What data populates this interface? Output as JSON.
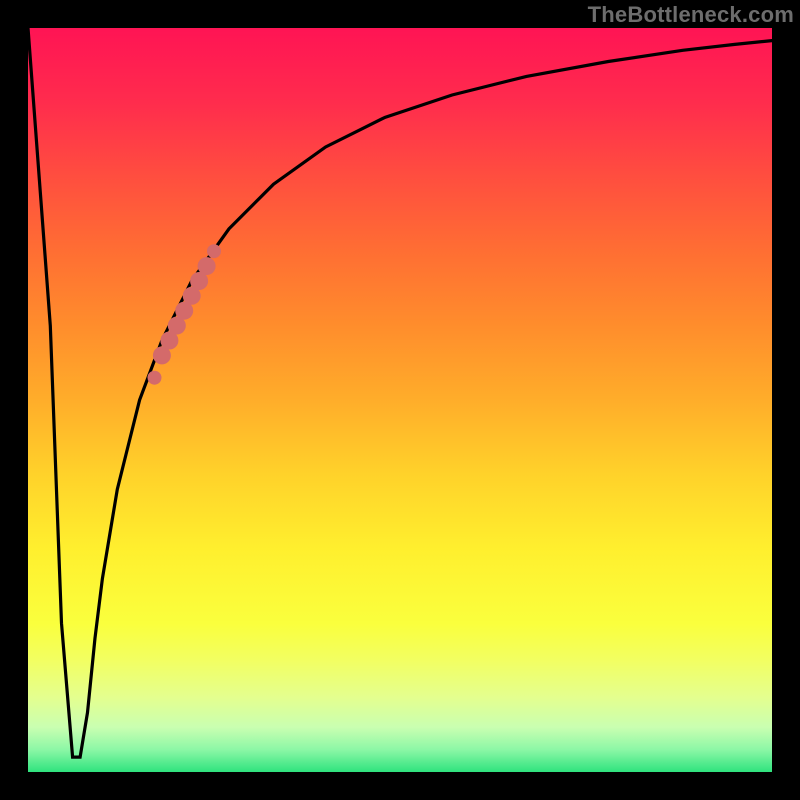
{
  "watermark": "TheBottleneck.com",
  "chart_data": {
    "type": "line",
    "title": "",
    "xlabel": "",
    "ylabel": "",
    "xlim": [
      0,
      100
    ],
    "ylim": [
      0,
      100
    ],
    "grid": false,
    "legend": false,
    "series": [
      {
        "name": "bottleneck-curve",
        "x": [
          0,
          3,
          4.5,
          6,
          7,
          8,
          9,
          10,
          12,
          15,
          18,
          22,
          27,
          33,
          40,
          48,
          57,
          67,
          78,
          88,
          95,
          100
        ],
        "values": [
          100,
          60,
          20,
          2,
          2,
          8,
          18,
          26,
          38,
          50,
          58,
          66,
          73,
          79,
          84,
          88,
          91,
          93.5,
          95.5,
          97,
          97.8,
          98.3
        ]
      },
      {
        "name": "highlight-segment",
        "x": [
          17,
          18,
          19,
          20,
          21,
          22,
          23,
          24,
          25
        ],
        "values": [
          53,
          56,
          58,
          60,
          62,
          64,
          66,
          68,
          70
        ]
      }
    ],
    "colors": {
      "curve": "#000000",
      "highlight": "#d46a6a"
    }
  }
}
